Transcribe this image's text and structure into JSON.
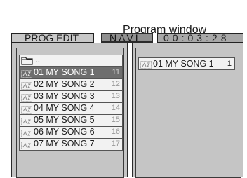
{
  "callout": {
    "label": "Program window"
  },
  "header": {
    "mode_label": "PROG EDIT",
    "navi_label": "NAVI",
    "elapsed_time": "00:03:28"
  },
  "browser": {
    "parent_folder_label": "..",
    "tracks": [
      {
        "name": "01 MY SONG 1",
        "number": "11",
        "selected": true
      },
      {
        "name": "02 MY SONG 2",
        "number": "12"
      },
      {
        "name": "03 MY SONG 3",
        "number": "13"
      },
      {
        "name": "04 MY SONG 4",
        "number": "14"
      },
      {
        "name": "05 MY SONG 5",
        "number": "15"
      },
      {
        "name": "06 MY SONG 6",
        "number": "16"
      },
      {
        "name": "07 MY SONG 7",
        "number": "17"
      }
    ]
  },
  "program": {
    "entries": [
      {
        "name": "01 MY SONG 1",
        "number": "1"
      }
    ]
  },
  "icons": {
    "folder": "folder-icon",
    "track": "music-file-icon"
  }
}
